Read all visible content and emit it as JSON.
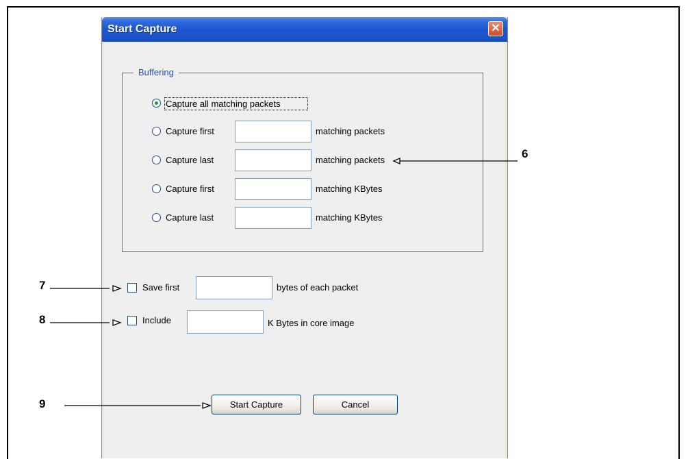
{
  "dialog": {
    "title": "Start Capture",
    "close_icon": "close-icon"
  },
  "buffering": {
    "legend": "Buffering",
    "options": [
      {
        "label": "Capture all matching packets",
        "selected": true
      },
      {
        "label": "Capture first",
        "suffix": "matching packets",
        "value": "",
        "selected": false
      },
      {
        "label": "Capture last",
        "suffix": "matching packets",
        "value": "",
        "selected": false
      },
      {
        "label": "Capture first",
        "suffix": "matching KBytes",
        "value": "",
        "selected": false
      },
      {
        "label": "Capture last",
        "suffix": "matching KBytes",
        "value": "",
        "selected": false
      }
    ]
  },
  "save_first": {
    "label": "Save first",
    "suffix": "bytes of each packet",
    "value": "",
    "checked": false
  },
  "include": {
    "label": "Include",
    "suffix": "K Bytes in core image",
    "value": "",
    "checked": false
  },
  "buttons": {
    "start": "Start Capture",
    "cancel": "Cancel"
  },
  "callouts": {
    "c6": "6",
    "c7": "7",
    "c8": "8",
    "c9": "9"
  },
  "colors": {
    "title_bar": "#1c57d0",
    "legend_text": "#1f4fc2",
    "radio_selected": "#22a035",
    "close_button": "#d14b26"
  }
}
